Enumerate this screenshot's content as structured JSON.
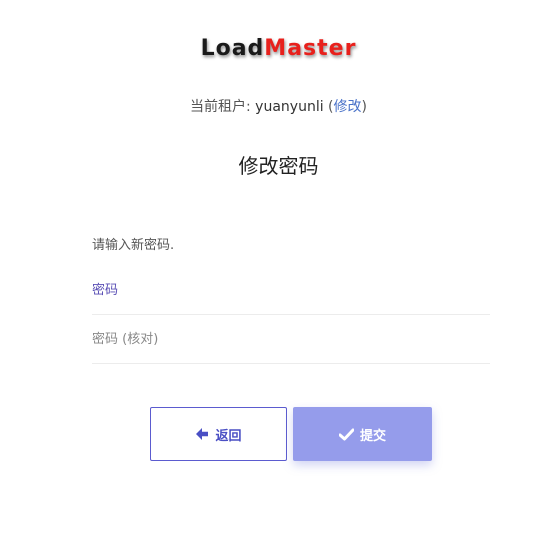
{
  "logo": {
    "part1": "Load",
    "part2": "Master",
    "colors": {
      "dark": "#1a1a1a",
      "red": "#e8201c"
    }
  },
  "tenant": {
    "label": "当前租户:",
    "name": "yuanyunli",
    "open_paren": "(",
    "change_link": "修改",
    "close_paren": ")"
  },
  "page_title": "修改密码",
  "prompt": "请输入新密码.",
  "fields": {
    "password": {
      "placeholder": "密码",
      "value": ""
    },
    "password_confirm": {
      "placeholder": "密码 (核对)",
      "value": ""
    }
  },
  "buttons": {
    "back": {
      "label": "返回",
      "icon": "arrow-left-icon"
    },
    "submit": {
      "label": "提交",
      "icon": "check-icon"
    }
  },
  "colors": {
    "accent": "#5b5bcf",
    "submit_bg": "#959ceb",
    "link": "#4a72c8"
  }
}
